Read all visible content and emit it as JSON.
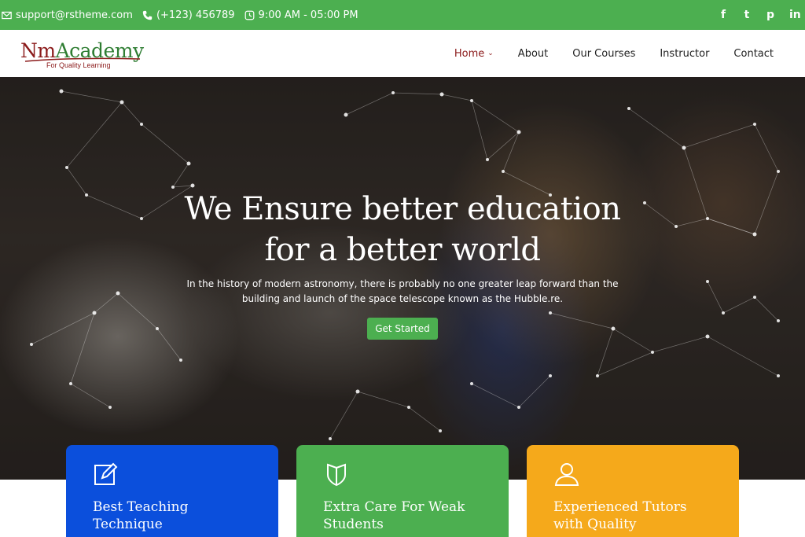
{
  "topbar": {
    "email": "support@rstheme.com",
    "phone": "(+123) 456789",
    "hours": "9:00 AM - 05:00 PM",
    "social": [
      "f",
      "t",
      "p",
      "in"
    ],
    "social_icons": [
      "facebook-icon",
      "twitter-icon",
      "pinterest-icon",
      "linkedin-icon"
    ]
  },
  "logo": {
    "name_part1": "Nm",
    "name_part2": "Academy",
    "tagline": "For Quality Learning"
  },
  "nav": {
    "items": [
      "Home",
      "About",
      "Our Courses",
      "Instructor",
      "Contact"
    ],
    "active": "Home"
  },
  "hero": {
    "headline_line1": "We Ensure better education",
    "headline_line2": "for a better world",
    "subtext_line1": "In the history of modern astronomy, there is probably no one greater leap forward than the",
    "subtext_line2": "building and launch of the space telescope known as the Hubble.re.",
    "cta_label": "Get Started"
  },
  "features": [
    {
      "line1": "Best Teaching",
      "line2": "Technique",
      "icon": "edit-icon"
    },
    {
      "line1": "Extra Care For Weak",
      "line2": "Students",
      "icon": "shield-icon"
    },
    {
      "line1": "Experienced Tutors",
      "line2": "with Quality",
      "icon": "user-icon"
    }
  ],
  "colors": {
    "green": "#4caf50",
    "brand_red": "#8b1a1a",
    "blue": "#0b4fdc",
    "orange": "#f5a91b"
  }
}
